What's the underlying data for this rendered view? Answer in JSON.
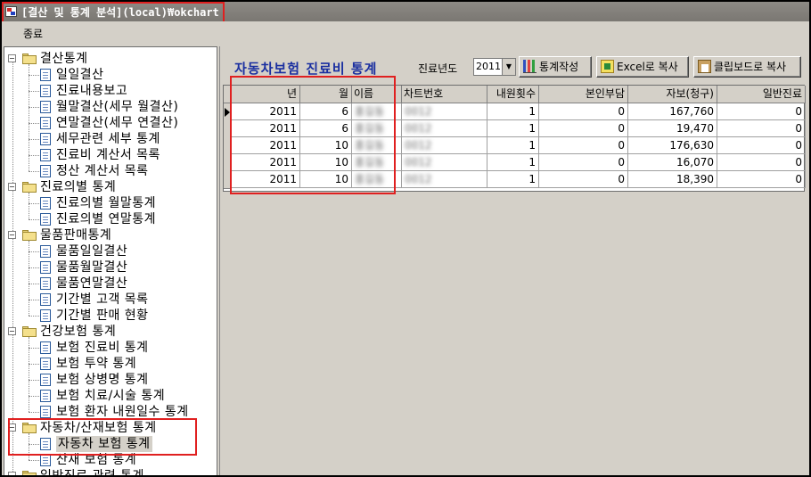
{
  "window": {
    "title": "[결산 및 통계 분석](local)₩okchart"
  },
  "menu": {
    "exit_label": "종료"
  },
  "tree": {
    "groups": [
      {
        "label": "결산통계",
        "items": [
          "일일결산",
          "진료내용보고",
          "월말결산(세무 월결산)",
          "연말결산(세무 연결산)",
          "세무관련 세부 통계",
          "진료비 계산서 목록",
          "정산 계산서 목록"
        ]
      },
      {
        "label": "진료의별 통계",
        "items": [
          "진료의별 월말통계",
          "진료의별 연말통계"
        ]
      },
      {
        "label": "물품판매통계",
        "items": [
          "물품일일결산",
          "물품월말결산",
          "물품연말결산",
          "기간별 고객 목록",
          "기간별 판매 현황"
        ]
      },
      {
        "label": "건강보험 통계",
        "items": [
          "보험 진료비 통계",
          "보험 투약 통계",
          "보험 상병명 통계",
          "보험 치료/시술 통계",
          "보험 환자 내원일수 통계"
        ]
      },
      {
        "label": "자동차/산재보험 통계",
        "items": [
          "자동차 보험 통계",
          "산재 보험 통계"
        ]
      },
      {
        "label": "일반진료 관련 통계",
        "items": []
      }
    ],
    "selected": "자동차 보험 통계"
  },
  "main": {
    "title": "자동차보험 진료비 통계",
    "year_label": "진료년도",
    "year_value": "2011",
    "buttons": {
      "stats": "통계작성",
      "excel": "Excel로 복사",
      "clipboard": "클립보드로 복사"
    }
  },
  "table": {
    "columns": [
      "년",
      "월",
      "이름",
      "차트번호",
      "내원횟수",
      "본인부담",
      "자보(청구)",
      "일반진료"
    ],
    "rows": [
      [
        "2011",
        "6",
        "홍길동",
        "0012",
        "1",
        "0",
        "167,760",
        "0"
      ],
      [
        "2011",
        "6",
        "홍길동",
        "0012",
        "1",
        "0",
        "19,470",
        "0"
      ],
      [
        "2011",
        "10",
        "홍길동",
        "0012",
        "1",
        "0",
        "176,630",
        "0"
      ],
      [
        "2011",
        "10",
        "홍길동",
        "0012",
        "1",
        "0",
        "16,070",
        "0"
      ],
      [
        "2011",
        "10",
        "홍길동",
        "0012",
        "1",
        "0",
        "18,390",
        "0"
      ]
    ]
  },
  "colors": {
    "title_blue": "#1a2fa0",
    "highlight_red": "#e02020",
    "chrome": "#d4d0c8"
  }
}
